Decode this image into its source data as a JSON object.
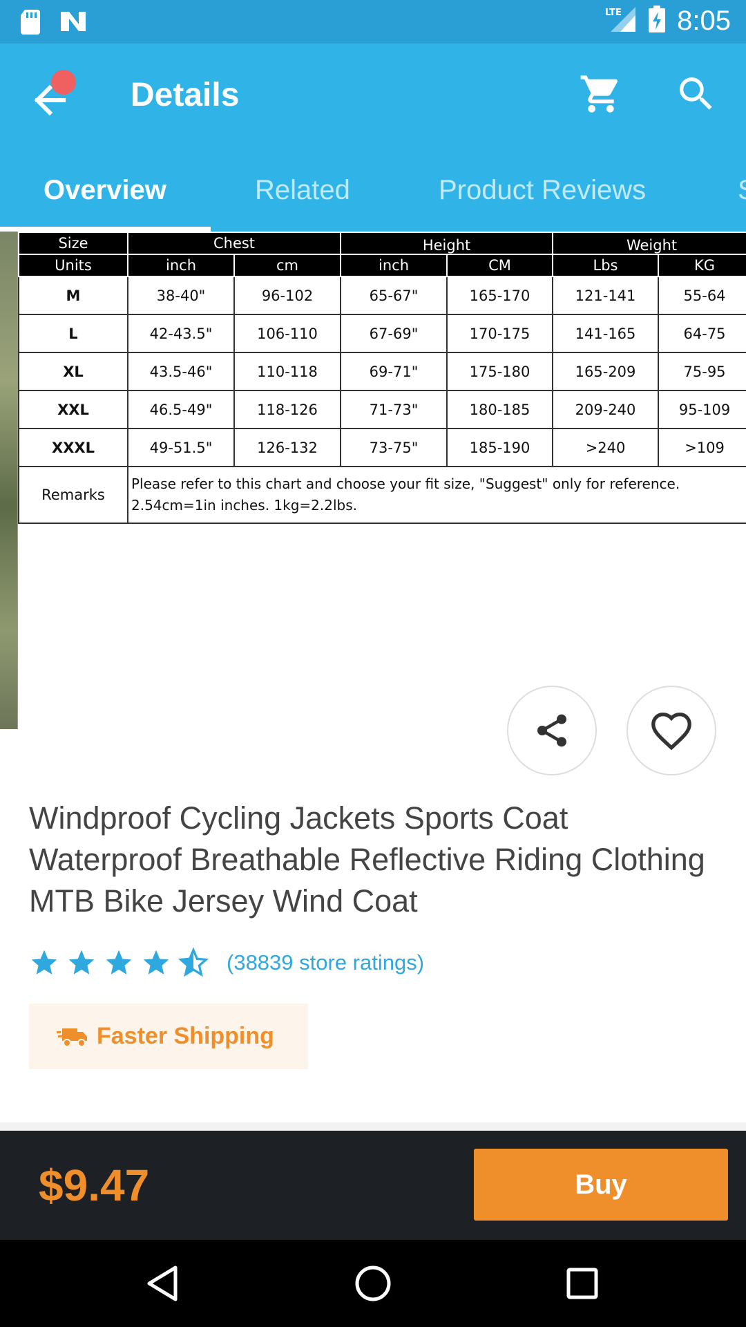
{
  "status_bar": {
    "time": "8:05",
    "network": "LTE",
    "left_icons": [
      "sd-card-icon",
      "notification-n-icon"
    ],
    "right_icons": [
      "signal-icon",
      "battery-charging-icon"
    ]
  },
  "app_bar": {
    "title": "Details",
    "back_icon": "arrow-back-icon",
    "cart_icon": "cart-icon",
    "search_icon": "search-icon"
  },
  "tabs": [
    {
      "label": "Overview",
      "active": true
    },
    {
      "label": "Related",
      "active": false
    },
    {
      "label": "Product Reviews",
      "active": false
    },
    {
      "label": "S",
      "active": false
    }
  ],
  "size_chart": {
    "header_row1": {
      "size": "Size",
      "chest": "Chest",
      "height": "Height",
      "weight": "Weight"
    },
    "units_row": [
      "Units",
      "inch",
      "cm",
      "inch",
      "CM",
      "Lbs",
      "KG"
    ],
    "rows": [
      [
        "M",
        "38-40\"",
        "96-102",
        "65-67\"",
        "165-170",
        "121-141",
        "55-64"
      ],
      [
        "L",
        "42-43.5\"",
        "106-110",
        "67-69\"",
        "170-175",
        "141-165",
        "64-75"
      ],
      [
        "XL",
        "43.5-46\"",
        "110-118",
        "69-71\"",
        "175-180",
        "165-209",
        "75-95"
      ],
      [
        "XXL",
        "46.5-49\"",
        "118-126",
        "71-73\"",
        "180-185",
        "209-240",
        "95-109"
      ],
      [
        "XXXL",
        "49-51.5\"",
        "126-132",
        "73-75\"",
        "185-190",
        ">240",
        ">109"
      ]
    ],
    "remarks_label": "Remarks",
    "remarks_line1": "Please refer to this chart and choose your fit size, \"Suggest\" only for reference.",
    "remarks_line2": "2.54cm=1in inches. 1kg=2.2lbs."
  },
  "actions": {
    "share_icon": "share-icon",
    "favorite_icon": "heart-outline-icon"
  },
  "product": {
    "title": "Windproof Cycling Jackets Sports Coat Waterproof Breathable Reflective Riding Clothing MTB Bike Jersey Wind Coat",
    "rating_value": 4.5,
    "rating_max": 5,
    "rating_count": "(38839 store ratings)",
    "shipping_label": "Faster Shipping",
    "shipping_icon": "truck-icon"
  },
  "buy_bar": {
    "price": "$9.47",
    "buy_label": "Buy"
  },
  "colors": {
    "status_bar": "#2a9fd6",
    "app_bar": "#30b4e8",
    "accent_orange": "#ef8f2b",
    "rating_blue": "#2fa7df",
    "buy_bar_bg": "#1d2125"
  },
  "nav_bar": {
    "icons": [
      "back-triangle-icon",
      "home-circle-icon",
      "recents-square-icon"
    ]
  }
}
